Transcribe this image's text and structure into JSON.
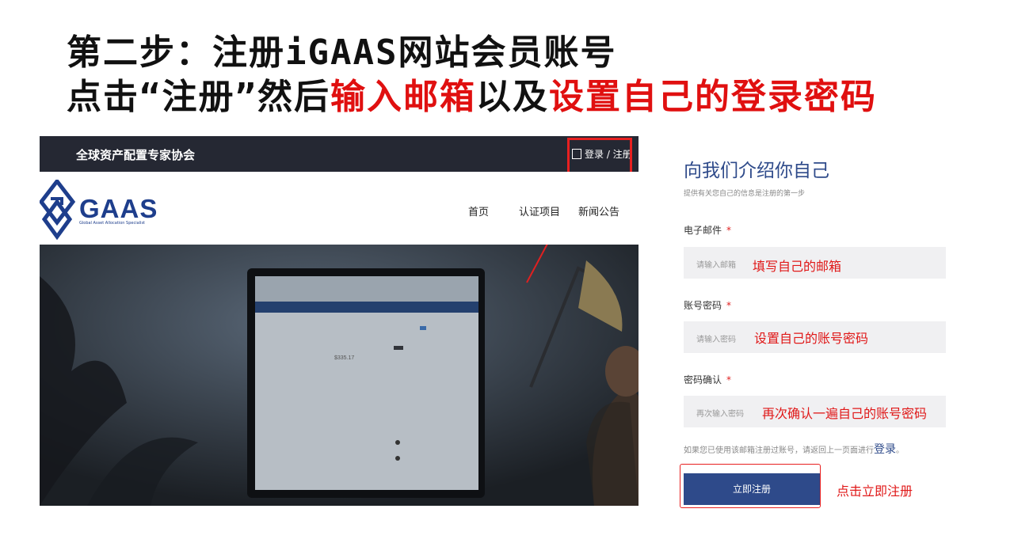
{
  "heading": {
    "line1": "第二步：注册iGAAS网站会员账号",
    "line2_part1": "点击“注册”然后",
    "line2_part2": "输入邮箱",
    "line2_part3": "以及",
    "line2_part4": "设置自己的登录密码"
  },
  "site": {
    "org_name": "全球资产配置专家协会",
    "login_link": "登录 / 注册",
    "logo_text": "GAAS",
    "logo_subtitle": "Global Asset Allocation Specialist",
    "nav": [
      "首页",
      "认证项目",
      "新闻公告"
    ],
    "hero_price": "$335.17"
  },
  "form": {
    "title": "向我们介绍你自己",
    "subtitle": "提供有关您自己的信息是注册的第一步",
    "fields": [
      {
        "label": "电子邮件",
        "required": "*",
        "placeholder": "请输入邮箱",
        "note": "填写自己的邮箱"
      },
      {
        "label": "账号密码",
        "required": "*",
        "placeholder": "请输入密码",
        "note": "设置自己的账号密码"
      },
      {
        "label": "密码确认",
        "required": "*",
        "placeholder": "再次输入密码",
        "note": "再次确认一遍自己的账号密码"
      }
    ],
    "hint_prefix": "如果您已使用该邮箱注册过账号，请返回上一页面进行",
    "hint_login": "登录",
    "hint_suffix": "。",
    "register_label": "立即注册",
    "register_note": "点击立即注册"
  },
  "colors": {
    "accent_red": "#e01010",
    "brand_blue": "#2e4a8a",
    "topbar": "#252833"
  }
}
